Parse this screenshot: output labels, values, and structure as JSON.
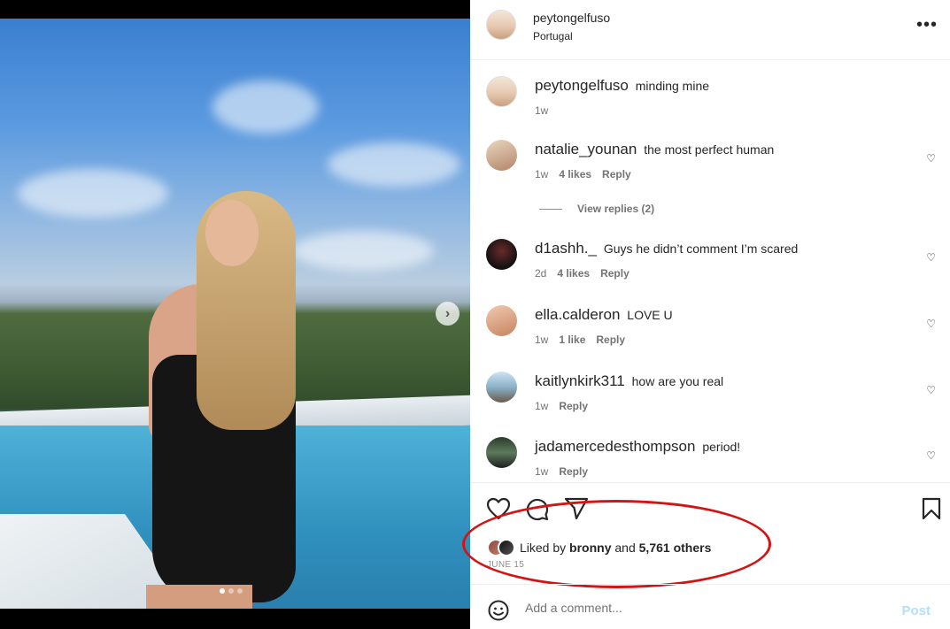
{
  "post": {
    "username": "peytongelfuso",
    "location": "Portugal",
    "more_icon": "more-horizontal-icon",
    "carousel": {
      "current_index": 1,
      "total": 3
    }
  },
  "caption": {
    "username": "peytongelfuso",
    "text": "minding mine",
    "time": "1w"
  },
  "comments": [
    {
      "username": "natalie_younan",
      "text": "the most perfect human",
      "time": "1w",
      "likes": "4 likes",
      "reply": "Reply"
    },
    {
      "username": "d1ashh._",
      "text": "Guys he didn’t comment I’m scared",
      "time": "2d",
      "likes": "4 likes",
      "reply": "Reply"
    },
    {
      "username": "ella.calderon",
      "text": "LOVE U",
      "time": "1w",
      "likes": "1 like",
      "reply": "Reply"
    },
    {
      "username": "kaitlynkirk311",
      "text": "how are you real",
      "time": "1w",
      "reply": "Reply"
    },
    {
      "username": "jadamercedesthompson",
      "text": "period!",
      "time": "1w",
      "reply": "Reply"
    }
  ],
  "view_replies": "View replies (2)",
  "likes": {
    "prefix": "Liked by",
    "user": "bronny",
    "middle": "and",
    "others": "5,761 others"
  },
  "date": "JUNE 15",
  "add_comment": {
    "placeholder": "Add a comment...",
    "post_label": "Post"
  },
  "colors": {
    "annotation": "#d31414",
    "post_disabled": "#b2dffc",
    "secondary_text": "#737373"
  }
}
